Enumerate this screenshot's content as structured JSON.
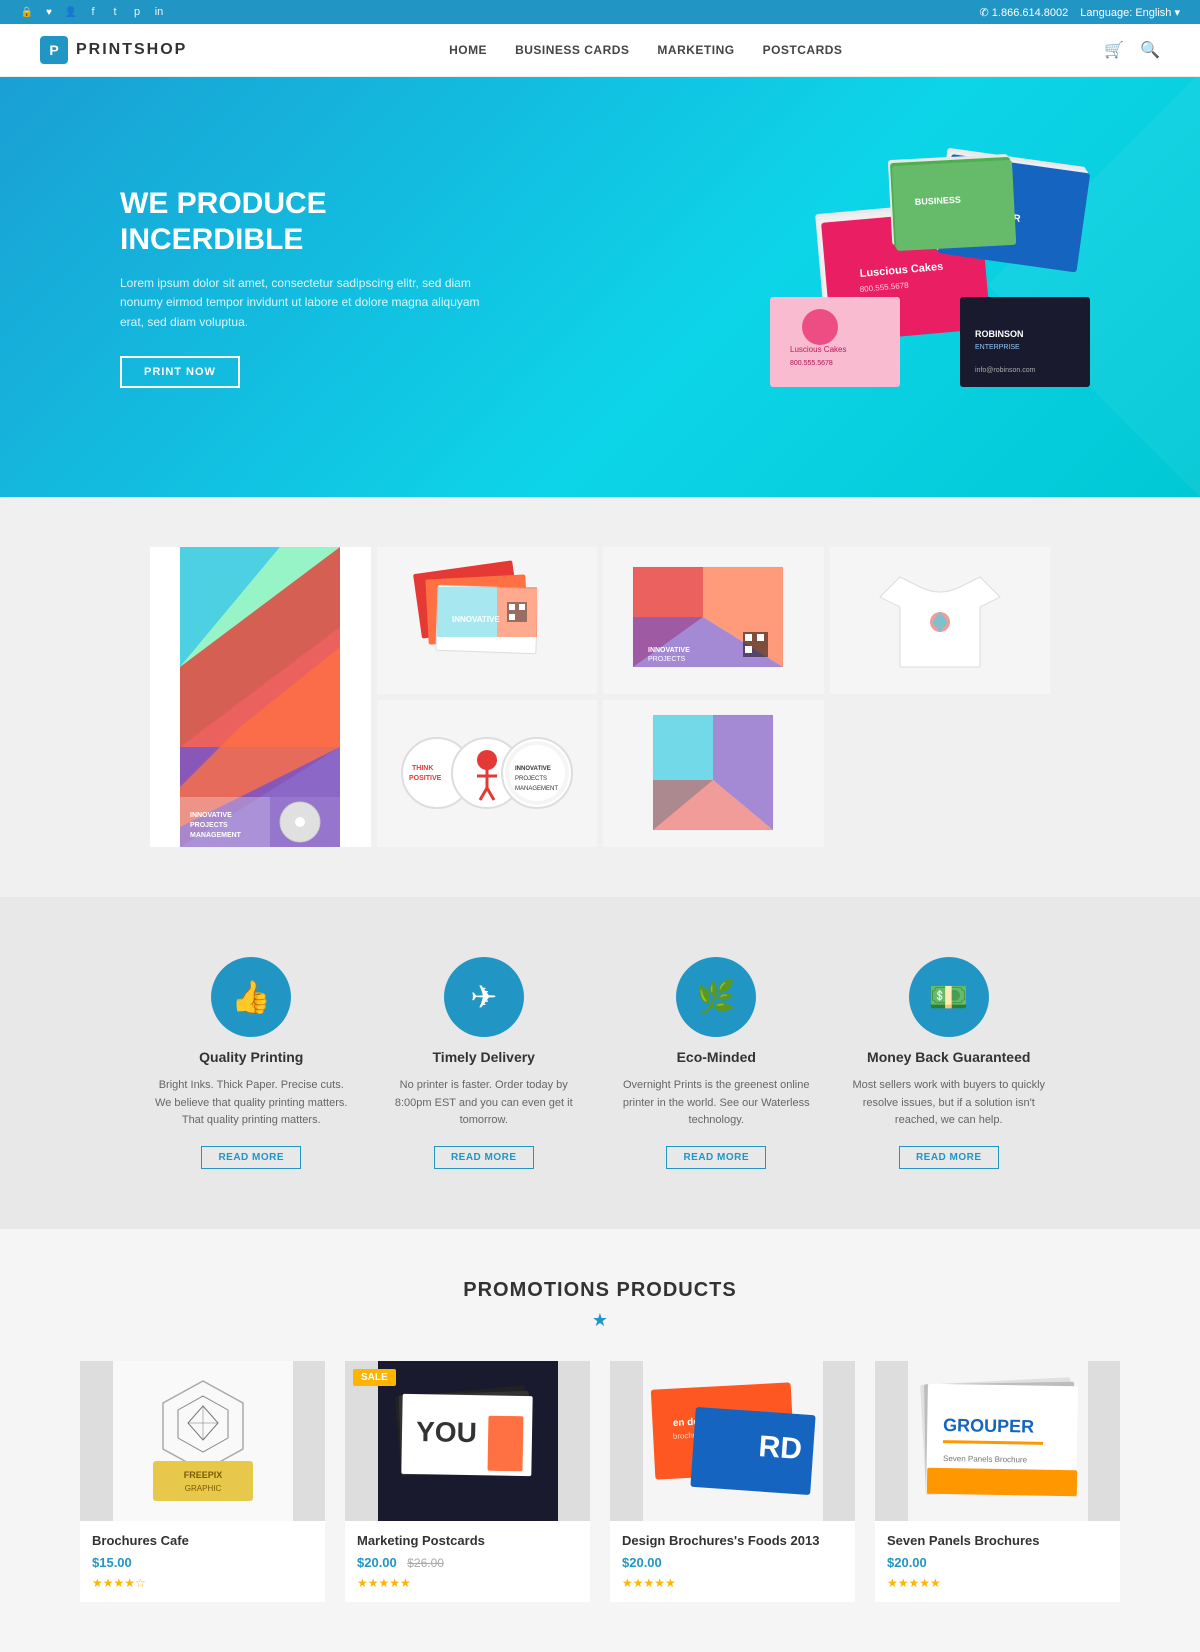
{
  "topbar": {
    "phone": "✆ 1.866.614.8002",
    "language": "Language: English ▾",
    "social_icons": [
      "🔒",
      "♥",
      "👤",
      "f",
      "t",
      "p",
      "in"
    ]
  },
  "header": {
    "logo_letter": "P",
    "logo_name": "PRINTSHOP",
    "nav": [
      {
        "label": "HOME"
      },
      {
        "label": "BUSINESS CARDS"
      },
      {
        "label": "MARKETING"
      },
      {
        "label": "POSTCARDS"
      }
    ]
  },
  "hero": {
    "title": "WE PRODUCE INCERDIBLE",
    "text": "Lorem ipsum dolor sit amet, consectetur sadipscing elitr, sed diam nonumy eirmod tempor invidunt ut labore et dolore magna aliquyam erat, sed diam voluptua.",
    "button_label": "PRINT NOW"
  },
  "features": [
    {
      "icon": "👍",
      "title": "Quality Printing",
      "desc": "Bright Inks. Thick Paper. Precise cuts. We believe that quality printing matters. That quality printing matters.",
      "btn": "READ MORE"
    },
    {
      "icon": "✈",
      "title": "Timely Delivery",
      "desc": "No printer is faster. Order today by 8:00pm EST and you can even get it tomorrow.",
      "btn": "READ MORE"
    },
    {
      "icon": "🌿",
      "title": "Eco-Minded",
      "desc": "Overnight Prints is the greenest online printer in the world. See our Waterless technology.",
      "btn": "READ MORE"
    },
    {
      "icon": "💵",
      "title": "Money Back Guaranteed",
      "desc": "Most sellers work with buyers to quickly resolve issues, but if a solution isn't reached, we can help.",
      "btn": "READ MORE"
    }
  ],
  "promotions": {
    "title": "PROMOTIONS PRODUCTS",
    "products": [
      {
        "name": "Brochures Cafe",
        "price": "$15.00",
        "old_price": "",
        "stars": 4,
        "sale": false
      },
      {
        "name": "Marketing Postcards",
        "price": "$20.00",
        "old_price": "$26.00",
        "stars": 5,
        "sale": true
      },
      {
        "name": "Design Brochures's Foods 2013",
        "price": "$20.00",
        "old_price": "",
        "stars": 5,
        "sale": false
      },
      {
        "name": "Seven Panels Brochures",
        "price": "$20.00",
        "old_price": "",
        "stars": 5,
        "sale": false
      }
    ]
  }
}
